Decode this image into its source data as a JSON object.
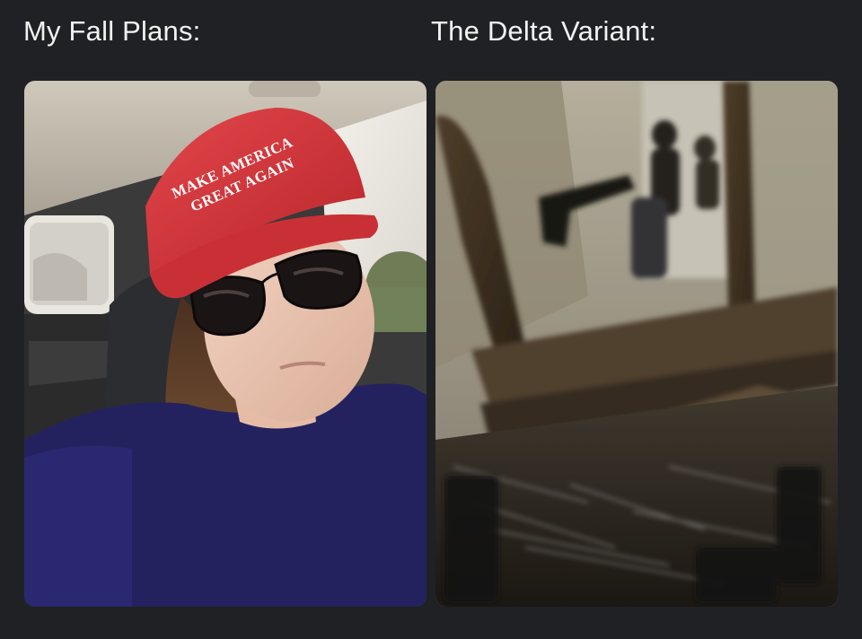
{
  "captions": {
    "left": "My Fall Plans:",
    "right": "The Delta Variant:"
  },
  "hat": {
    "line1": "MAKE AMERICA",
    "line2": "GREAT AGAIN"
  },
  "colors": {
    "background": "#1f2124",
    "caption_text": "#f2f2f2",
    "hat_red": "#d9383f",
    "shirt_navy": "#24225e"
  }
}
